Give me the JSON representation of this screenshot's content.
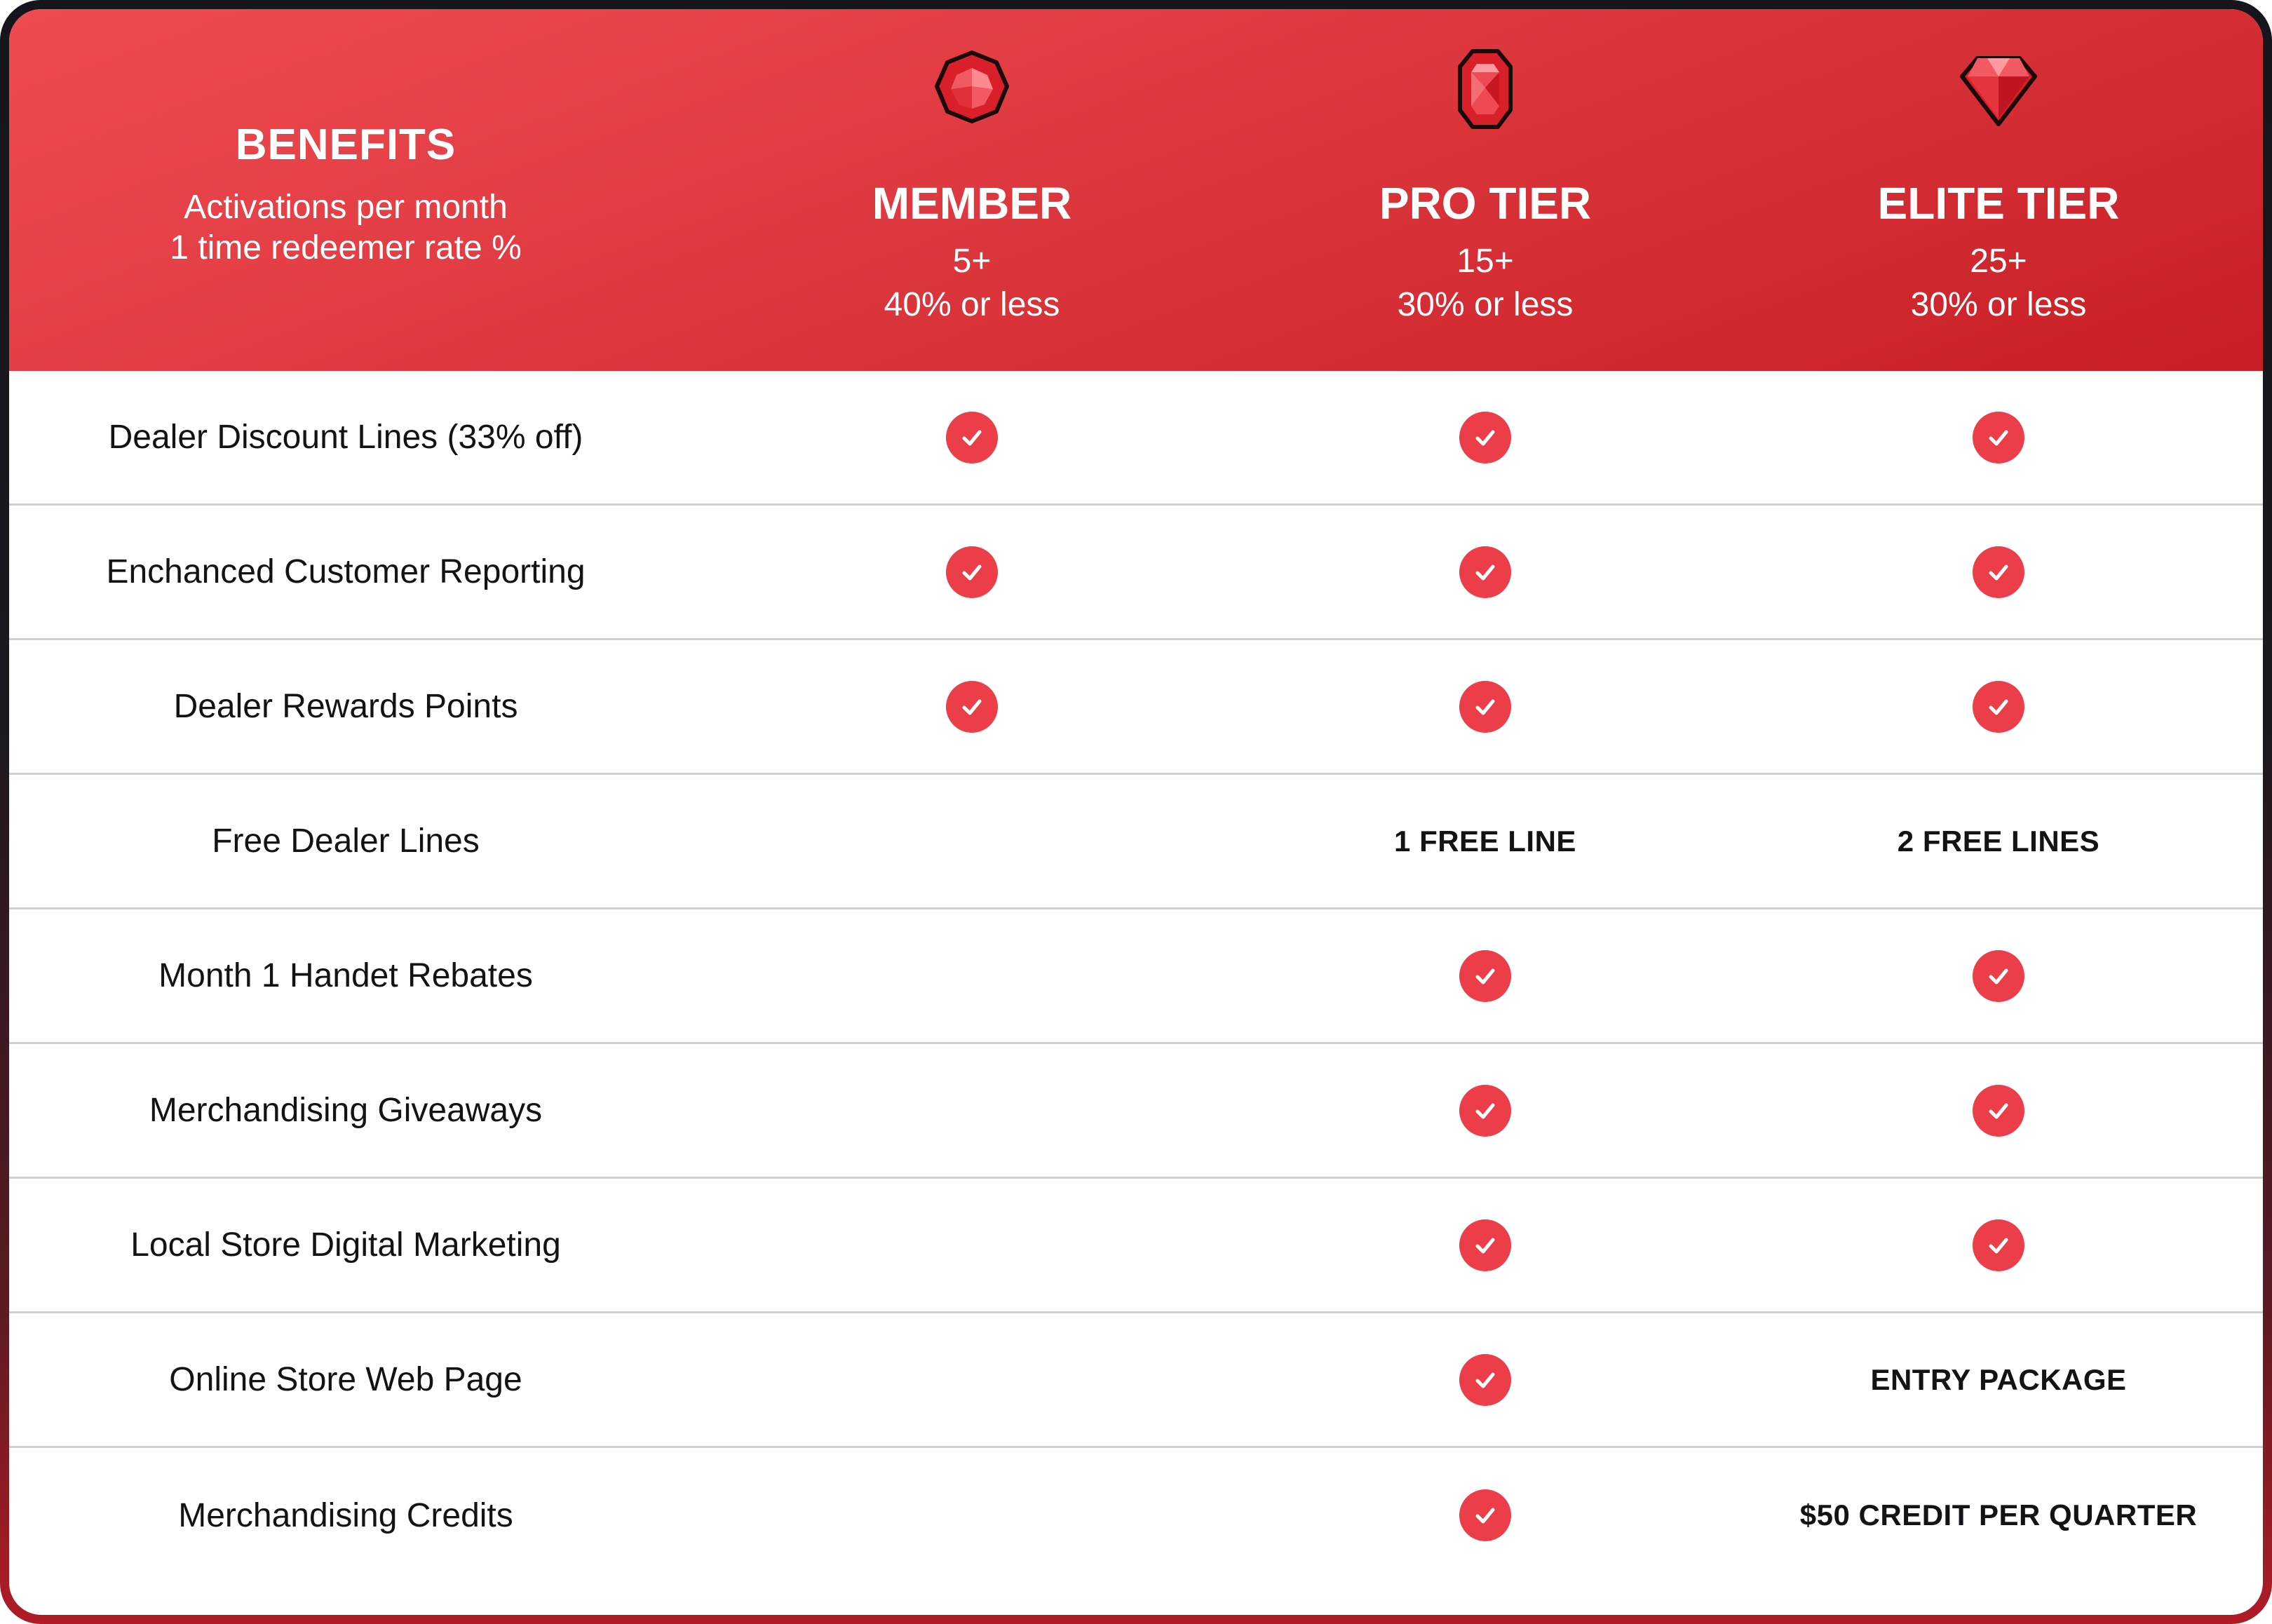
{
  "header": {
    "benefits_title": "BENEFITS",
    "benefits_sub1": "Activations per month",
    "benefits_sub2": "1 time redeemer rate %",
    "tiers": [
      {
        "name": "MEMBER",
        "activations": "5+",
        "rate": "40% or less",
        "icon": "ruby-round-gem-icon"
      },
      {
        "name": "PRO TIER",
        "activations": "15+",
        "rate": "30% or less",
        "icon": "ruby-emerald-cut-gem-icon"
      },
      {
        "name": "ELITE TIER",
        "activations": "25+",
        "rate": "30% or less",
        "icon": "ruby-diamond-gem-icon"
      }
    ]
  },
  "colors": {
    "header_start": "#ee4b51",
    "header_end": "#c81f26",
    "check": "#ec3e48",
    "divider": "#cfcfd4",
    "text": "#111317"
  },
  "rows": [
    {
      "label": "Dealer Discount Lines (33% off)",
      "values": [
        "check",
        "check",
        "check"
      ]
    },
    {
      "label": "Enchanced Customer Reporting",
      "values": [
        "check",
        "check",
        "check"
      ]
    },
    {
      "label": "Dealer Rewards Points",
      "values": [
        "check",
        "check",
        "check"
      ]
    },
    {
      "label": "Free Dealer Lines",
      "values": [
        "",
        "1 FREE LINE",
        "2 FREE LINES"
      ]
    },
    {
      "label": "Month 1 Handet Rebates",
      "values": [
        "",
        "check",
        "check"
      ]
    },
    {
      "label": "Merchandising Giveaways",
      "values": [
        "",
        "check",
        "check"
      ]
    },
    {
      "label": "Local Store Digital Marketing",
      "values": [
        "",
        "check",
        "check"
      ]
    },
    {
      "label": "Online Store Web Page",
      "values": [
        "",
        "check",
        "ENTRY PACKAGE"
      ]
    },
    {
      "label": "Merchandising Credits",
      "values": [
        "",
        "check",
        "$50 CREDIT PER QUARTER"
      ]
    }
  ]
}
